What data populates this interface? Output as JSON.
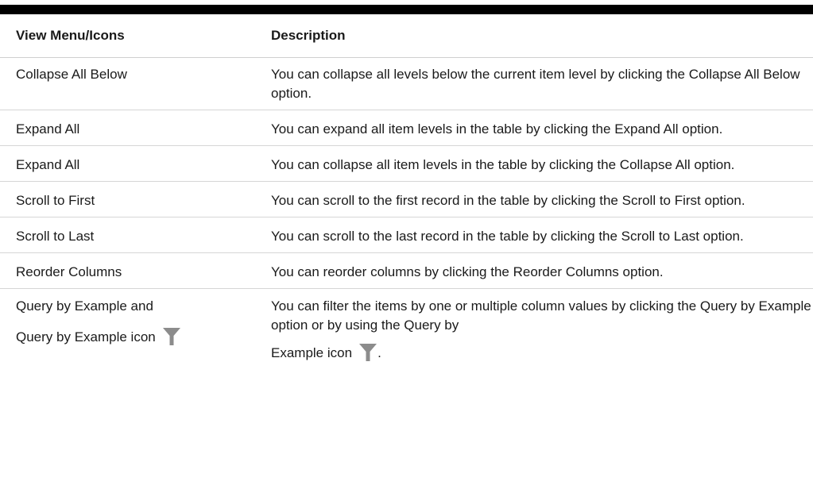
{
  "table": {
    "headers": [
      "View Menu/Icons",
      "Description"
    ],
    "rows": [
      {
        "name": "Collapse All Below",
        "desc": "You can collapse all levels below the current item level by clicking the Collapse All Below option."
      },
      {
        "name": "Expand All",
        "desc": "You can expand all item levels in the table by clicking the Expand All option."
      },
      {
        "name": "Expand All",
        "desc": "You can collapse all item levels in the table by clicking the Collapse All option."
      },
      {
        "name": "Scroll to First",
        "desc": "You can scroll to the first record in the table by clicking the Scroll to First option."
      },
      {
        "name": "Scroll to Last",
        "desc": "You can scroll to the last record in the table by clicking the Scroll to Last option."
      },
      {
        "name": "Reorder Columns",
        "desc": "You can reorder columns by clicking the Reorder Columns option."
      }
    ],
    "last_row": {
      "name_line1": "Query by Example and",
      "name_line2": "Query by Example icon",
      "desc_main": "You can filter the items by one or multiple column values by clicking the Query by Example option or by using the Query by",
      "desc_tail": "Example icon",
      "desc_end": "."
    },
    "icon": "filter-funnel-icon",
    "icon_color": "#8c8c8c"
  }
}
